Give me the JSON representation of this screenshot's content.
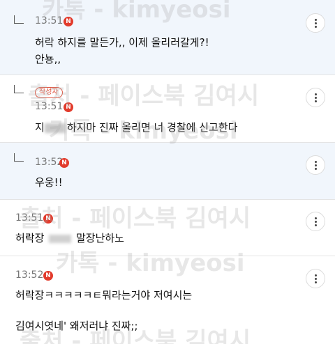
{
  "watermark": {
    "line1": "카톡 - kimyeosi",
    "line2": "출처 - 페이스북 김여시",
    "color": "#aaaaaa"
  },
  "comments": [
    {
      "time": "13:51",
      "badge": "N",
      "lines": [
        "허락 하지를 말든가,, 이제 올리러갈게?!",
        "안뇽,,"
      ]
    },
    {
      "time": "13:51",
      "badge": "N",
      "author_badge": "작성자",
      "line_prefix": "지",
      "line_rest": "하지마 진짜 올리면 너 경찰에 신고한다"
    },
    {
      "time": "13:52",
      "badge": "N",
      "lines": [
        "우웅!!"
      ]
    },
    {
      "time": "13:51",
      "badge": "N",
      "line_prefix": "허락장",
      "line_rest": "말장난하노"
    },
    {
      "time": "13:52",
      "badge": "N",
      "lines": [
        "허락장ㅋㅋㅋㅋㅋㅌ뭐라는거야 저여시는",
        "김여시엿네' 왜저러냐 진짜;;"
      ]
    }
  ],
  "colors": {
    "reply_bg": "#f1f6fc",
    "badge_red": "#e23b2c",
    "author_badge": "#e0533e"
  },
  "icons": {
    "more": "more-vertical-icon",
    "reply": "reply-arrow-icon",
    "new": "new-badge-icon"
  }
}
